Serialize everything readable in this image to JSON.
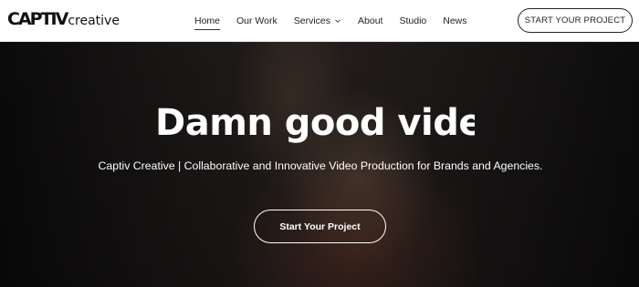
{
  "brand": {
    "logo_bold": "CAPTIV",
    "logo_light": "creative"
  },
  "nav": {
    "items": [
      {
        "label": "Home",
        "active": true
      },
      {
        "label": "Our Work"
      },
      {
        "label": "Services",
        "has_dropdown": true
      },
      {
        "label": "About"
      },
      {
        "label": "Studio"
      },
      {
        "label": "News"
      }
    ],
    "cta_label": "START YOUR PROJECT"
  },
  "hero": {
    "headline": "Damn good videos",
    "subheadline": "Captiv Creative | Collaborative and Innovative Video Production for Brands and Agencies.",
    "cta_label": "Start Your Project"
  },
  "colors": {
    "header_bg": "#ffffff",
    "hero_text": "#ffffff",
    "text_dark": "#222222"
  }
}
